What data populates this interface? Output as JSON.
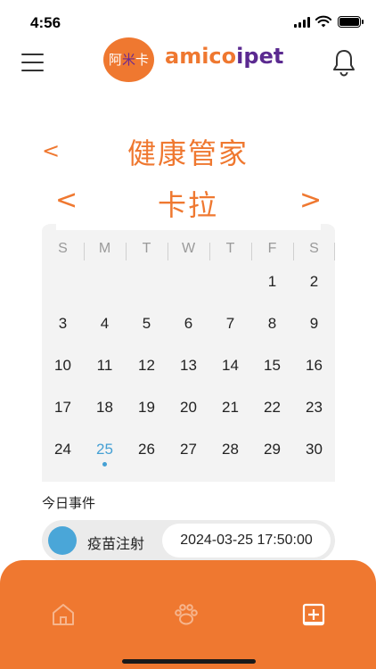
{
  "status_bar": {
    "time": "4:56"
  },
  "header": {
    "logo_badge": [
      "阿",
      "米",
      "卡"
    ],
    "logo_text_a": "amico",
    "logo_text_b": "ipet",
    "menu_icon": "hamburger-menu-icon",
    "notification_icon": "bell-icon"
  },
  "page": {
    "back_symbol": "<",
    "title": "健康管家",
    "prev_pet_symbol": "<",
    "pet_name": "卡拉",
    "next_pet_symbol": ">"
  },
  "calendar": {
    "weekdays": [
      "S",
      "M",
      "T",
      "W",
      "T",
      "F",
      "S"
    ],
    "weeks": [
      [
        "",
        "",
        "",
        "",
        "",
        "1",
        "2"
      ],
      [
        "3",
        "4",
        "5",
        "6",
        "7",
        "8",
        "9"
      ],
      [
        "10",
        "11",
        "12",
        "13",
        "14",
        "15",
        "16"
      ],
      [
        "17",
        "18",
        "19",
        "20",
        "21",
        "22",
        "23"
      ],
      [
        "24",
        "25",
        "26",
        "27",
        "28",
        "29",
        "30"
      ]
    ],
    "today": "25",
    "today_color": "#45a0d4"
  },
  "events": {
    "section_label": "今日事件",
    "items": [
      {
        "name": "疫苗注射",
        "time": "2024-03-25 17:50:00",
        "color": "#4aa6d8"
      }
    ]
  },
  "tab_bar": {
    "tabs": [
      {
        "icon": "home-icon"
      },
      {
        "icon": "paw-icon"
      },
      {
        "icon": "add-square-icon"
      }
    ],
    "color": "#ef7830"
  },
  "colors": {
    "accent": "#ef7830",
    "brand_purple": "#5b2a90"
  }
}
